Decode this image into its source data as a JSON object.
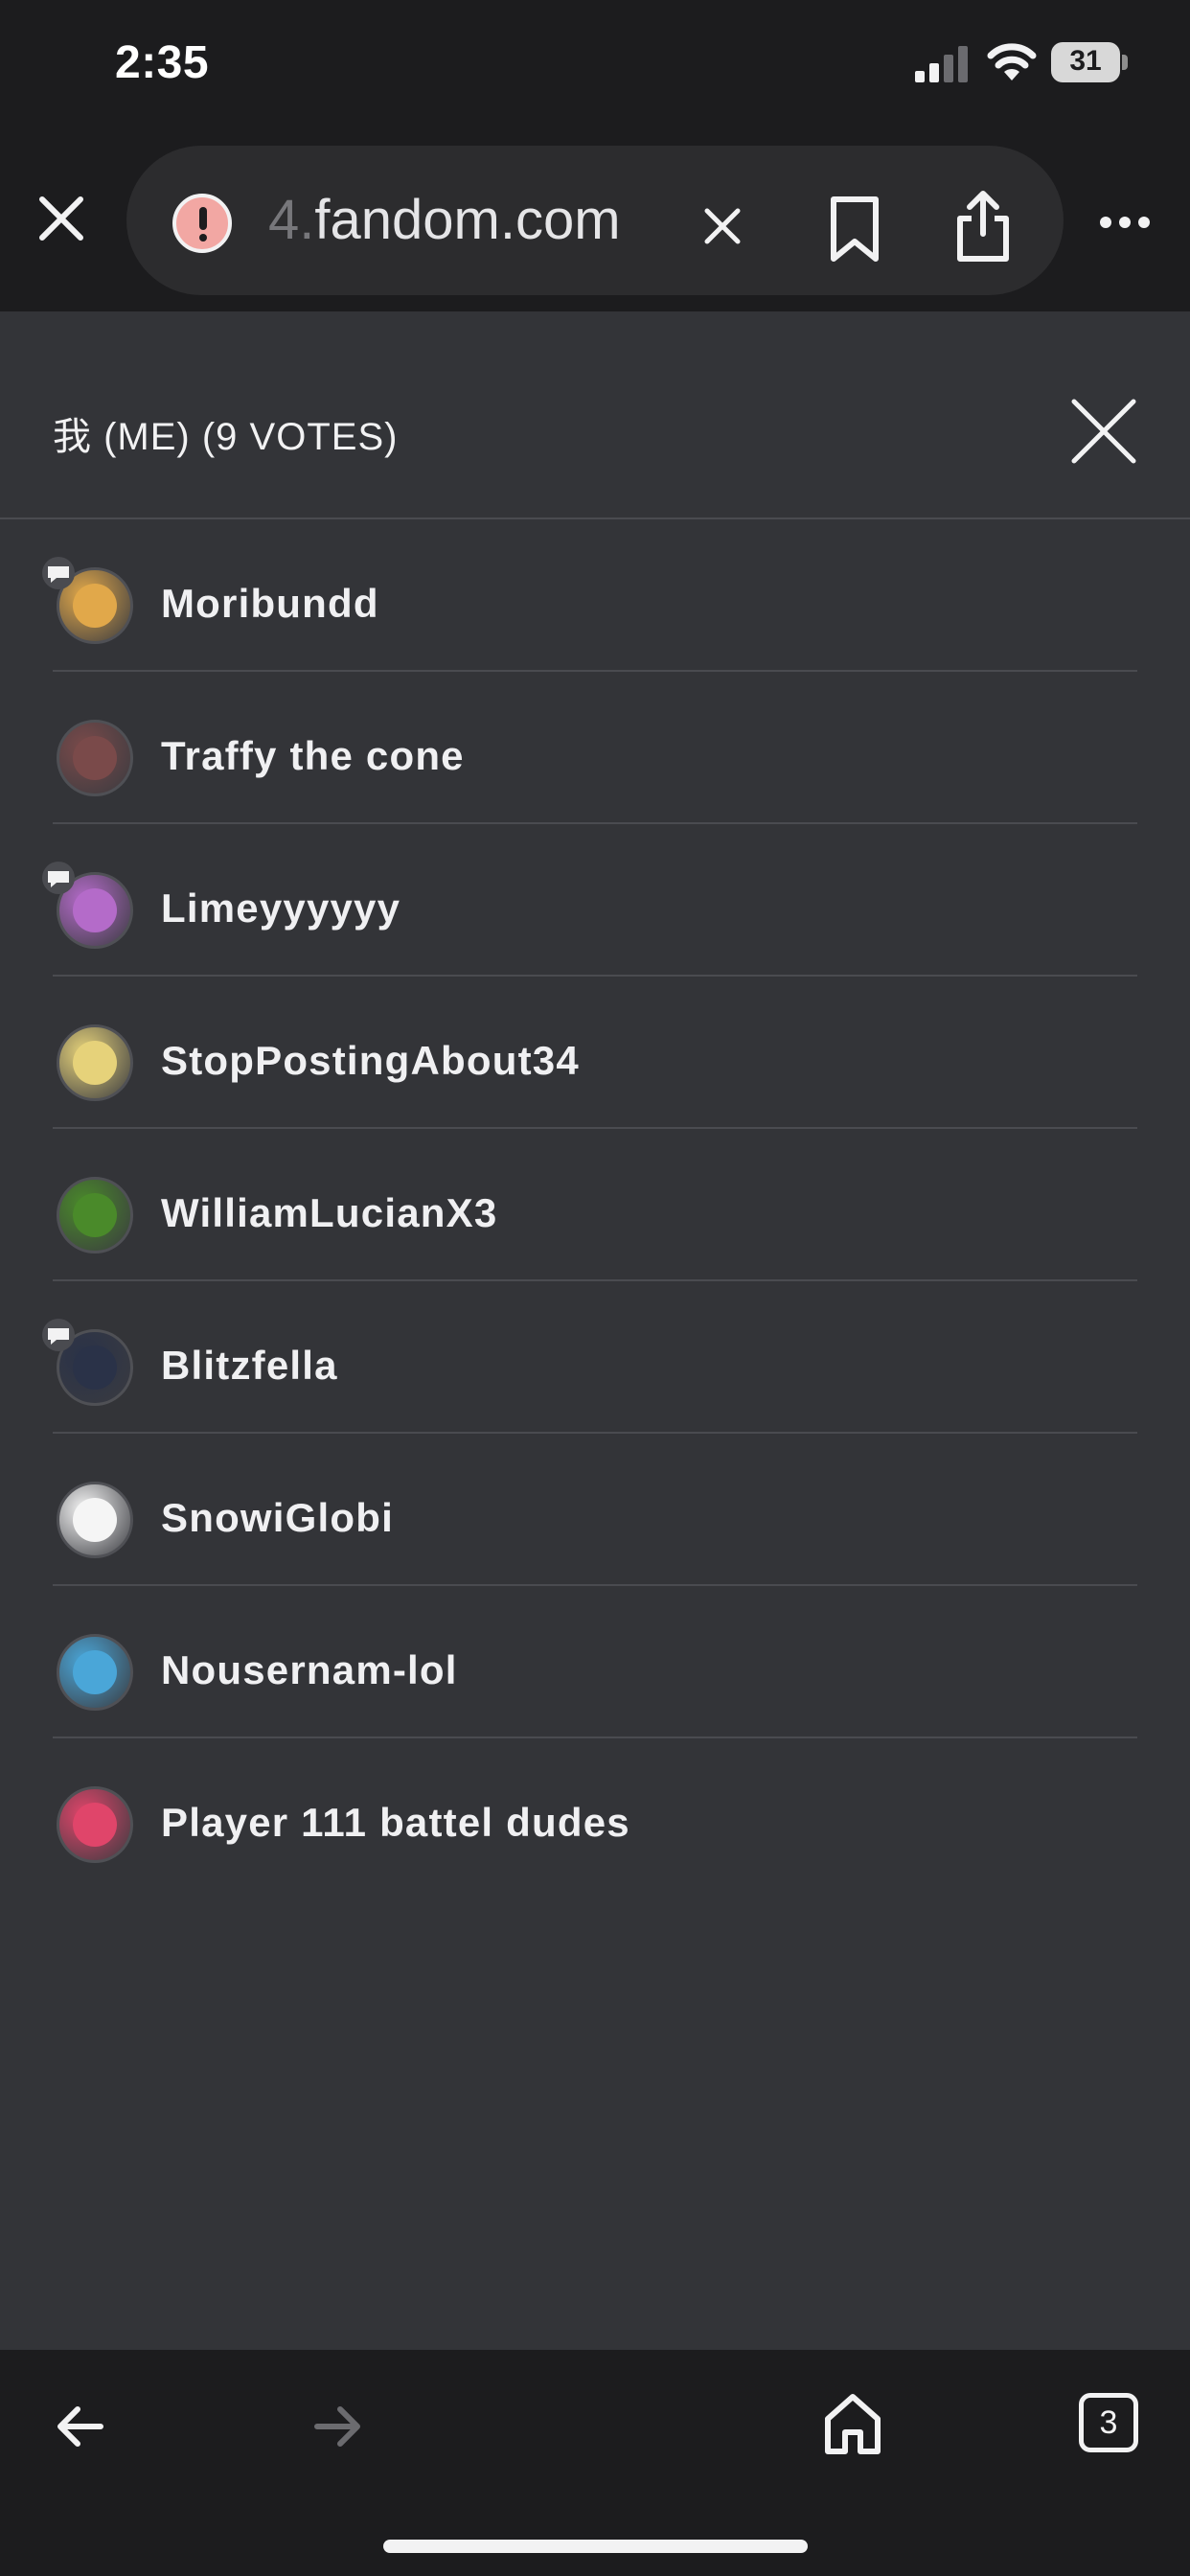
{
  "status_bar": {
    "time": "2:35",
    "battery_level": "31"
  },
  "browser": {
    "url_prefix": "4.",
    "url_domain": "fandom.com",
    "tab_count": "3"
  },
  "modal": {
    "title": "我 (ME) (9 VOTES)",
    "voters": [
      {
        "name": "Moribundd",
        "has_badge": true,
        "avatar_color": "#e1a84a"
      },
      {
        "name": "Traffy the cone",
        "has_badge": false,
        "avatar_color": "#7a4a4a"
      },
      {
        "name": "Limeyyyyyy",
        "has_badge": true,
        "avatar_color": "#b46bc9"
      },
      {
        "name": "StopPostingAbout34",
        "has_badge": false,
        "avatar_color": "#e6d27a"
      },
      {
        "name": "WilliamLucianX3",
        "has_badge": false,
        "avatar_color": "#4a8a2a"
      },
      {
        "name": "Blitzfella",
        "has_badge": true,
        "avatar_color": "#2a3248"
      },
      {
        "name": "SnowiGlobi",
        "has_badge": false,
        "avatar_color": "#f5f5f5"
      },
      {
        "name": "Nousernam-lol",
        "has_badge": false,
        "avatar_color": "#4aa6d8"
      },
      {
        "name": "Player 111 battel dudes",
        "has_badge": false,
        "avatar_color": "#e0456a"
      }
    ]
  },
  "colors": {
    "chrome_bg": "#1c1c1e",
    "modal_bg": "#333438",
    "divider": "#4a4b50"
  }
}
